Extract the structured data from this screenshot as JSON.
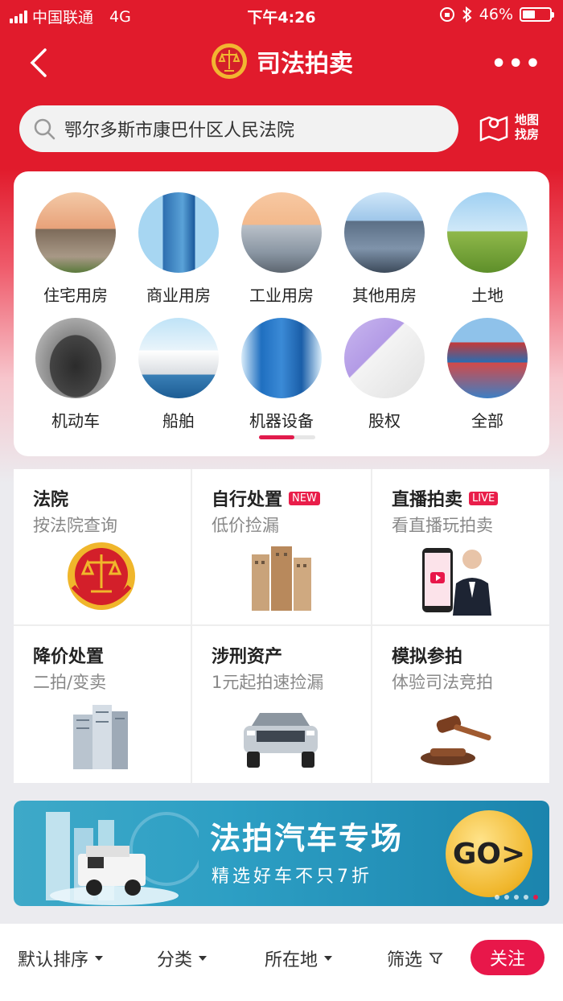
{
  "status": {
    "carrier": "中国联通",
    "network": "4G",
    "time": "下午4:26",
    "battery": "46%",
    "battery_level": 0.46
  },
  "nav": {
    "title": "司法拍卖",
    "more": "•••"
  },
  "search": {
    "value": "鄂尔多斯市康巴什区人民法院"
  },
  "map_button": {
    "line1": "地图",
    "line2": "找房"
  },
  "categories": [
    {
      "label": "住宅用房",
      "icon": "house-photo"
    },
    {
      "label": "商业用房",
      "icon": "tower-photo"
    },
    {
      "label": "工业用房",
      "icon": "factory-photo"
    },
    {
      "label": "其他用房",
      "icon": "office-building-photo"
    },
    {
      "label": "土地",
      "icon": "grassland-photo"
    },
    {
      "label": "机动车",
      "icon": "car-photo"
    },
    {
      "label": "船舶",
      "icon": "cruise-ship-photo"
    },
    {
      "label": "机器设备",
      "icon": "machinery-photo"
    },
    {
      "label": "股权",
      "icon": "contract-photo"
    },
    {
      "label": "全部",
      "icon": "containers-photo"
    }
  ],
  "features": [
    {
      "title": "法院",
      "subtitle": "按法院查询",
      "badge": "",
      "icon": "court-emblem-icon"
    },
    {
      "title": "自行处置",
      "subtitle": "低价捡漏",
      "badge": "NEW",
      "icon": "apartment-building-icon"
    },
    {
      "title": "直播拍卖",
      "subtitle": "看直播玩拍卖",
      "badge": "LIVE",
      "icon": "livestream-icon"
    },
    {
      "title": "降价处置",
      "subtitle": "二拍/变卖",
      "badge": "",
      "icon": "highrise-icon"
    },
    {
      "title": "涉刑资产",
      "subtitle": "1元起拍速捡漏",
      "badge": "",
      "icon": "suv-icon"
    },
    {
      "title": "模拟参拍",
      "subtitle": "体验司法竞拍",
      "badge": "",
      "icon": "gavel-icon"
    }
  ],
  "banner": {
    "title": "法拍汽车专场",
    "subtitle": "精选好车不只7折",
    "cta": "GO>"
  },
  "sort_bar": {
    "default": "默认排序",
    "category": "分类",
    "location": "所在地",
    "filter": "筛选",
    "follow": "关注"
  },
  "colors": {
    "brand_red": "#e11b2c",
    "accent_pink": "#e8174a"
  }
}
